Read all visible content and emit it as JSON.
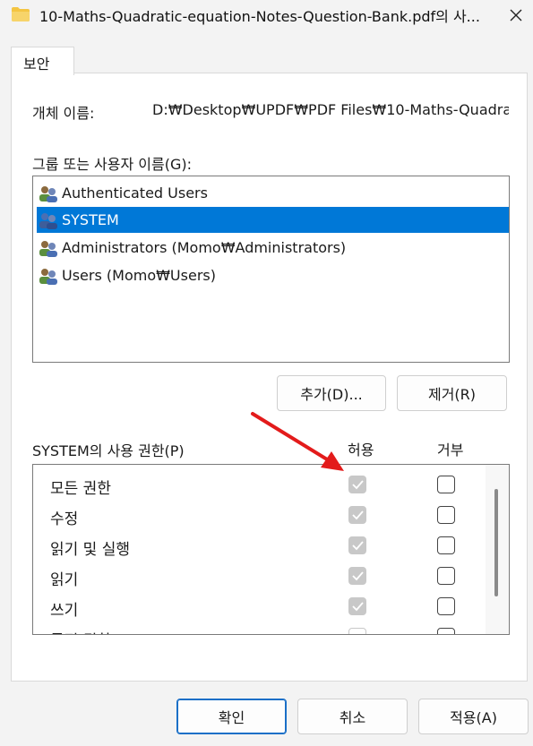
{
  "window": {
    "title": "10-Maths-Quadratic-equation-Notes-Question-Bank.pdf의 사...",
    "close_label": "✕"
  },
  "tabs": [
    {
      "label": "보안"
    }
  ],
  "object": {
    "label": "개체 이름:",
    "value": "D:₩Desktop₩UPDF₩PDF Files₩10-Maths-Quadra"
  },
  "groups": {
    "label": "그룹 또는 사용자 이름(G):",
    "items": [
      {
        "label": "Authenticated Users",
        "selected": false
      },
      {
        "label": "SYSTEM",
        "selected": true
      },
      {
        "label": "Administrators (Momo₩Administrators)",
        "selected": false
      },
      {
        "label": "Users (Momo₩Users)",
        "selected": false
      }
    ],
    "add_button": "추가(D)...",
    "remove_button": "제거(R)"
  },
  "permissions": {
    "label": "SYSTEM의 사용 권한(P)",
    "allow_header": "허용",
    "deny_header": "거부",
    "rows": [
      {
        "name": "모든 권한",
        "allow": true,
        "deny": false
      },
      {
        "name": "수정",
        "allow": true,
        "deny": false
      },
      {
        "name": "읽기 및 실행",
        "allow": true,
        "deny": false
      },
      {
        "name": "읽기",
        "allow": true,
        "deny": false
      },
      {
        "name": "쓰기",
        "allow": true,
        "deny": false
      },
      {
        "name": "특정 권한",
        "allow": false,
        "deny": false
      }
    ]
  },
  "footer": {
    "ok_button": "확인",
    "cancel_button": "취소",
    "apply_button": "적용(A)"
  },
  "colors": {
    "selection": "#0078d7",
    "annotation_arrow": "#e31b1b",
    "checkbox_disabled": "#c8c8c8"
  }
}
